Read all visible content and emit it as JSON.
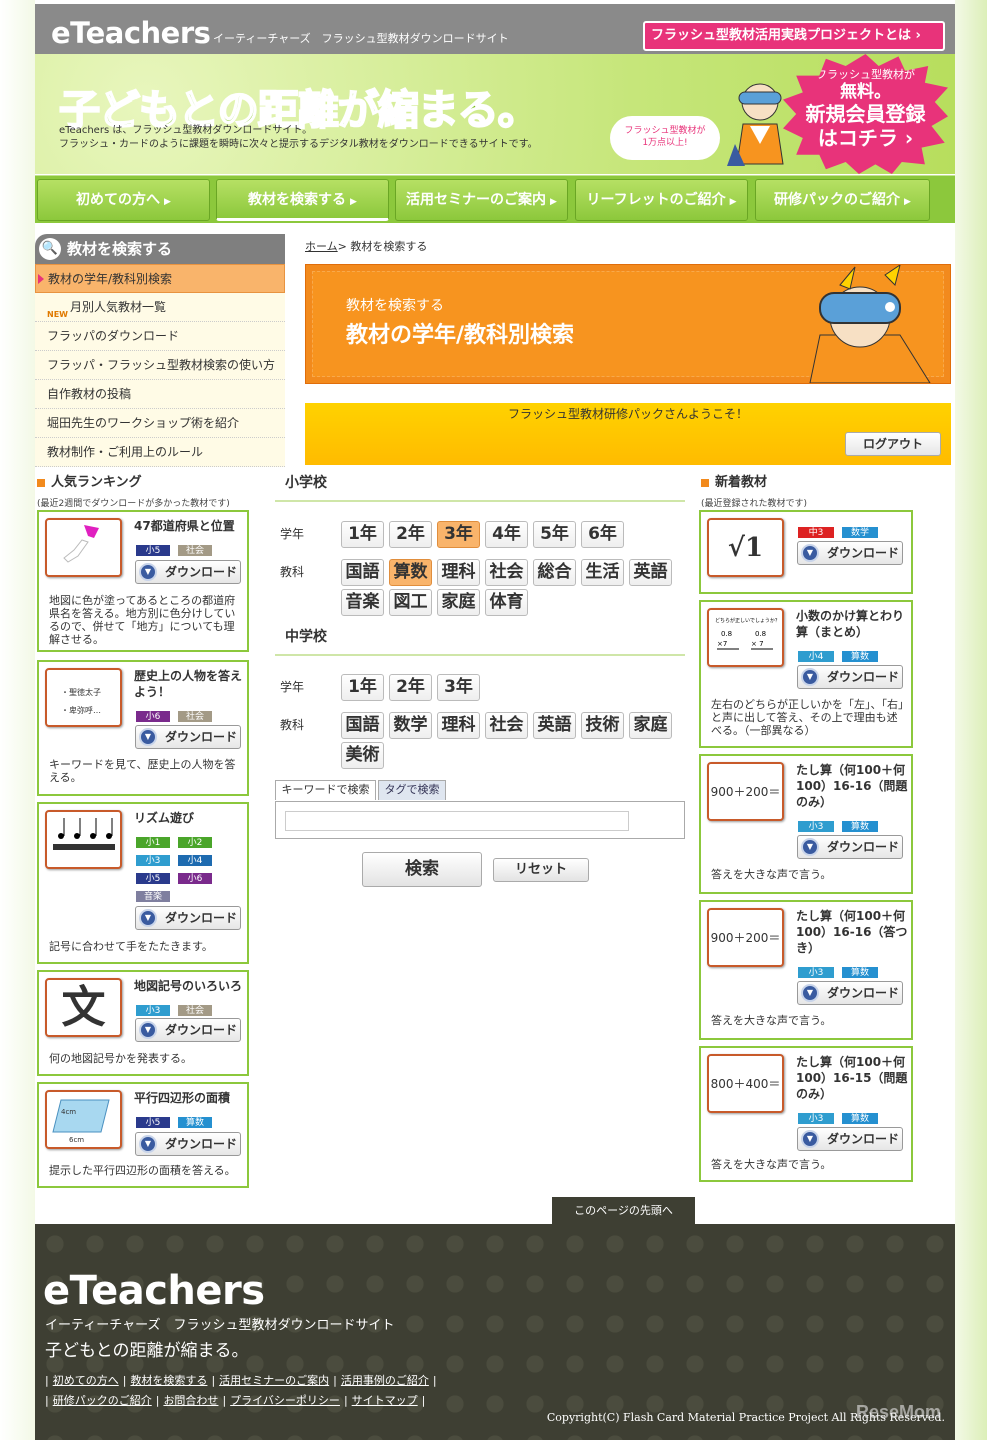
{
  "header": {
    "logo": "eTeachers",
    "logo_sub": "イーティーチャーズ　フラッシュ型教材ダウンロードサイト",
    "top_button": "フラッシュ型教材活用実践プロジェクトとは ›"
  },
  "banner": {
    "title": "子どもとの距離が縮まる。",
    "desc1": "eTeachers は、フラッシュ型教材ダウンロードサイト。",
    "desc2": "フラッシュ・カードのように課題を瞬時に次々と提示するデジタル教材をダウンロードできるサイトです。",
    "bubble1": "フラッシュ型教材が",
    "bubble2": "1万点以上!",
    "star1": "フラッシュ型教材が",
    "star2": "無料。",
    "star3": "新規会員登録",
    "star4": "はコチラ ›"
  },
  "nav": [
    "初めての方へ",
    "教材を検索する",
    "活用セミナーのご案内",
    "リーフレットのご紹介",
    "研修パックのご紹介"
  ],
  "sidebar": {
    "title": "教材を検索する",
    "items": [
      "教材の学年/教科別検索",
      "月別人気教材一覧",
      "フラッパのダウンロード",
      "フラッパ・フラッシュ型教材検索の使い方",
      "自作教材の投稿",
      "堀田先生のワークショップ術を紹介",
      "教材制作・ご利用上のルール"
    ],
    "new": "NEW"
  },
  "breadcrumb": {
    "home": "ホーム",
    "sep": ">",
    "current": "教材を検索する"
  },
  "page_head": {
    "t1": "教材を検索する",
    "t2": "教材の学年/教科別検索"
  },
  "welcome": {
    "text": "フラッシュ型教材研修パックさんようこそ！",
    "logout": "ログアウト"
  },
  "ranking": {
    "title": "人気ランキング",
    "sub": "(最近2週間でダウンロードが多かった教材です)",
    "download": "ダウンロード",
    "cards": [
      {
        "title": "47都道府県と位置",
        "tags": [
          "小5",
          "社会"
        ],
        "desc": "地図に色が塗ってあるところの都道府県名を答える。地方別に色分けしているので、併せて「地方」についても理解させる。"
      },
      {
        "title": "歴史上の人物を答えよう！",
        "tags": [
          "小6",
          "社会"
        ],
        "thumb": [
          "・聖徳太子",
          "・卑弥呼…"
        ],
        "desc": "キーワードを見て、歴史上の人物を答える。"
      },
      {
        "title": "リズム遊び",
        "tags": [
          "小1",
          "小2",
          "小3",
          "小4",
          "小5",
          "小6",
          "音楽"
        ],
        "desc": "記号に合わせて手をたたきます。"
      },
      {
        "title": "地図記号のいろいろ",
        "tags": [
          "小3",
          "社会"
        ],
        "thumb": "文",
        "desc": "何の地図記号かを発表する。"
      },
      {
        "title": "平行四辺形の面積",
        "tags": [
          "小5",
          "算数"
        ],
        "thumb": [
          "4cm",
          "6cm"
        ],
        "desc": "提示した平行四辺形の面積を答える。"
      }
    ]
  },
  "search": {
    "elem": "小学校",
    "mid": "中学校",
    "grade_label": "学年",
    "subject_label": "教科",
    "elem_grades": [
      "1年",
      "2年",
      "3年",
      "4年",
      "5年",
      "6年"
    ],
    "elem_subjects": [
      "国語",
      "算数",
      "理科",
      "社会",
      "総合",
      "生活",
      "英語",
      "音楽",
      "図工",
      "家庭",
      "体育"
    ],
    "mid_grades": [
      "1年",
      "2年",
      "3年"
    ],
    "mid_subjects": [
      "国語",
      "数学",
      "理科",
      "社会",
      "英語",
      "技術",
      "家庭",
      "美術"
    ],
    "tab_kw": "キーワードで検索",
    "tab_tag": "タグで検索",
    "kw_value": "",
    "search_btn": "検索",
    "reset_btn": "リセット"
  },
  "newitems": {
    "title": "新着教材",
    "sub": "(最近登録された教材です)",
    "cards": [
      {
        "title": "",
        "tags": [
          "中3",
          "数学"
        ],
        "thumb": "√1",
        "desc": ""
      },
      {
        "title": "小数のかけ算とわり算（まとめ）",
        "tags": [
          "小4",
          "算数"
        ],
        "desc": "左右のどちらが正しいかを「左」、「右」と声に出して答え、その上で理由も述べる。（一部異なる）"
      },
      {
        "title": "たし算（何100＋何100）16-16（問題のみ）",
        "tags": [
          "小3",
          "算数"
        ],
        "thumb": "900＋200＝",
        "desc": "答えを大きな声で言う。"
      },
      {
        "title": "たし算（何100＋何100）16-16（答つき）",
        "tags": [
          "小3",
          "算数"
        ],
        "thumb": "900＋200＝",
        "desc": "答えを大きな声で言う。"
      },
      {
        "title": "たし算（何100＋何100）16-15（問題のみ）",
        "tags": [
          "小3",
          "算数"
        ],
        "thumb": "800＋400＝",
        "desc": "答えを大きな声で言う。"
      }
    ]
  },
  "pagetop": "このページの先頭へ",
  "footer": {
    "logo": "eTeachers",
    "sub": "イーティーチャーズ　フラッシュ型教材ダウンロードサイト",
    "tag": "子どもとの距離が縮まる。",
    "links1": [
      "初めての方へ",
      "教材を検索する",
      "活用セミナーのご案内",
      "活用事例のご紹介"
    ],
    "links2": [
      "研修パックのご紹介",
      "お問合わせ",
      "プライバシーポリシー",
      "サイトマップ"
    ],
    "copyright": "Copyright(C) Flash Card Material Practice Project All Rights Reserved.",
    "watermark": "ReseMom"
  }
}
